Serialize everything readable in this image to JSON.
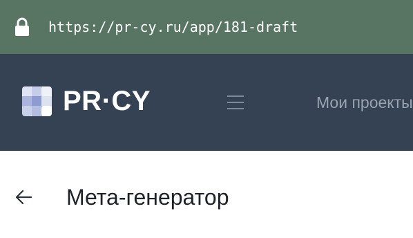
{
  "browser": {
    "url": "https://pr-cy.ru/app/181-draft",
    "lock_icon": "lock-icon",
    "bar_color": "#587463"
  },
  "header": {
    "logo_text": "PR·CY",
    "menu_icon": "hamburger-icon",
    "nav_item": "Мои проекты",
    "bg_color": "#344254"
  },
  "page": {
    "back_icon": "arrow-left-icon",
    "title": "Мета-генератор"
  }
}
